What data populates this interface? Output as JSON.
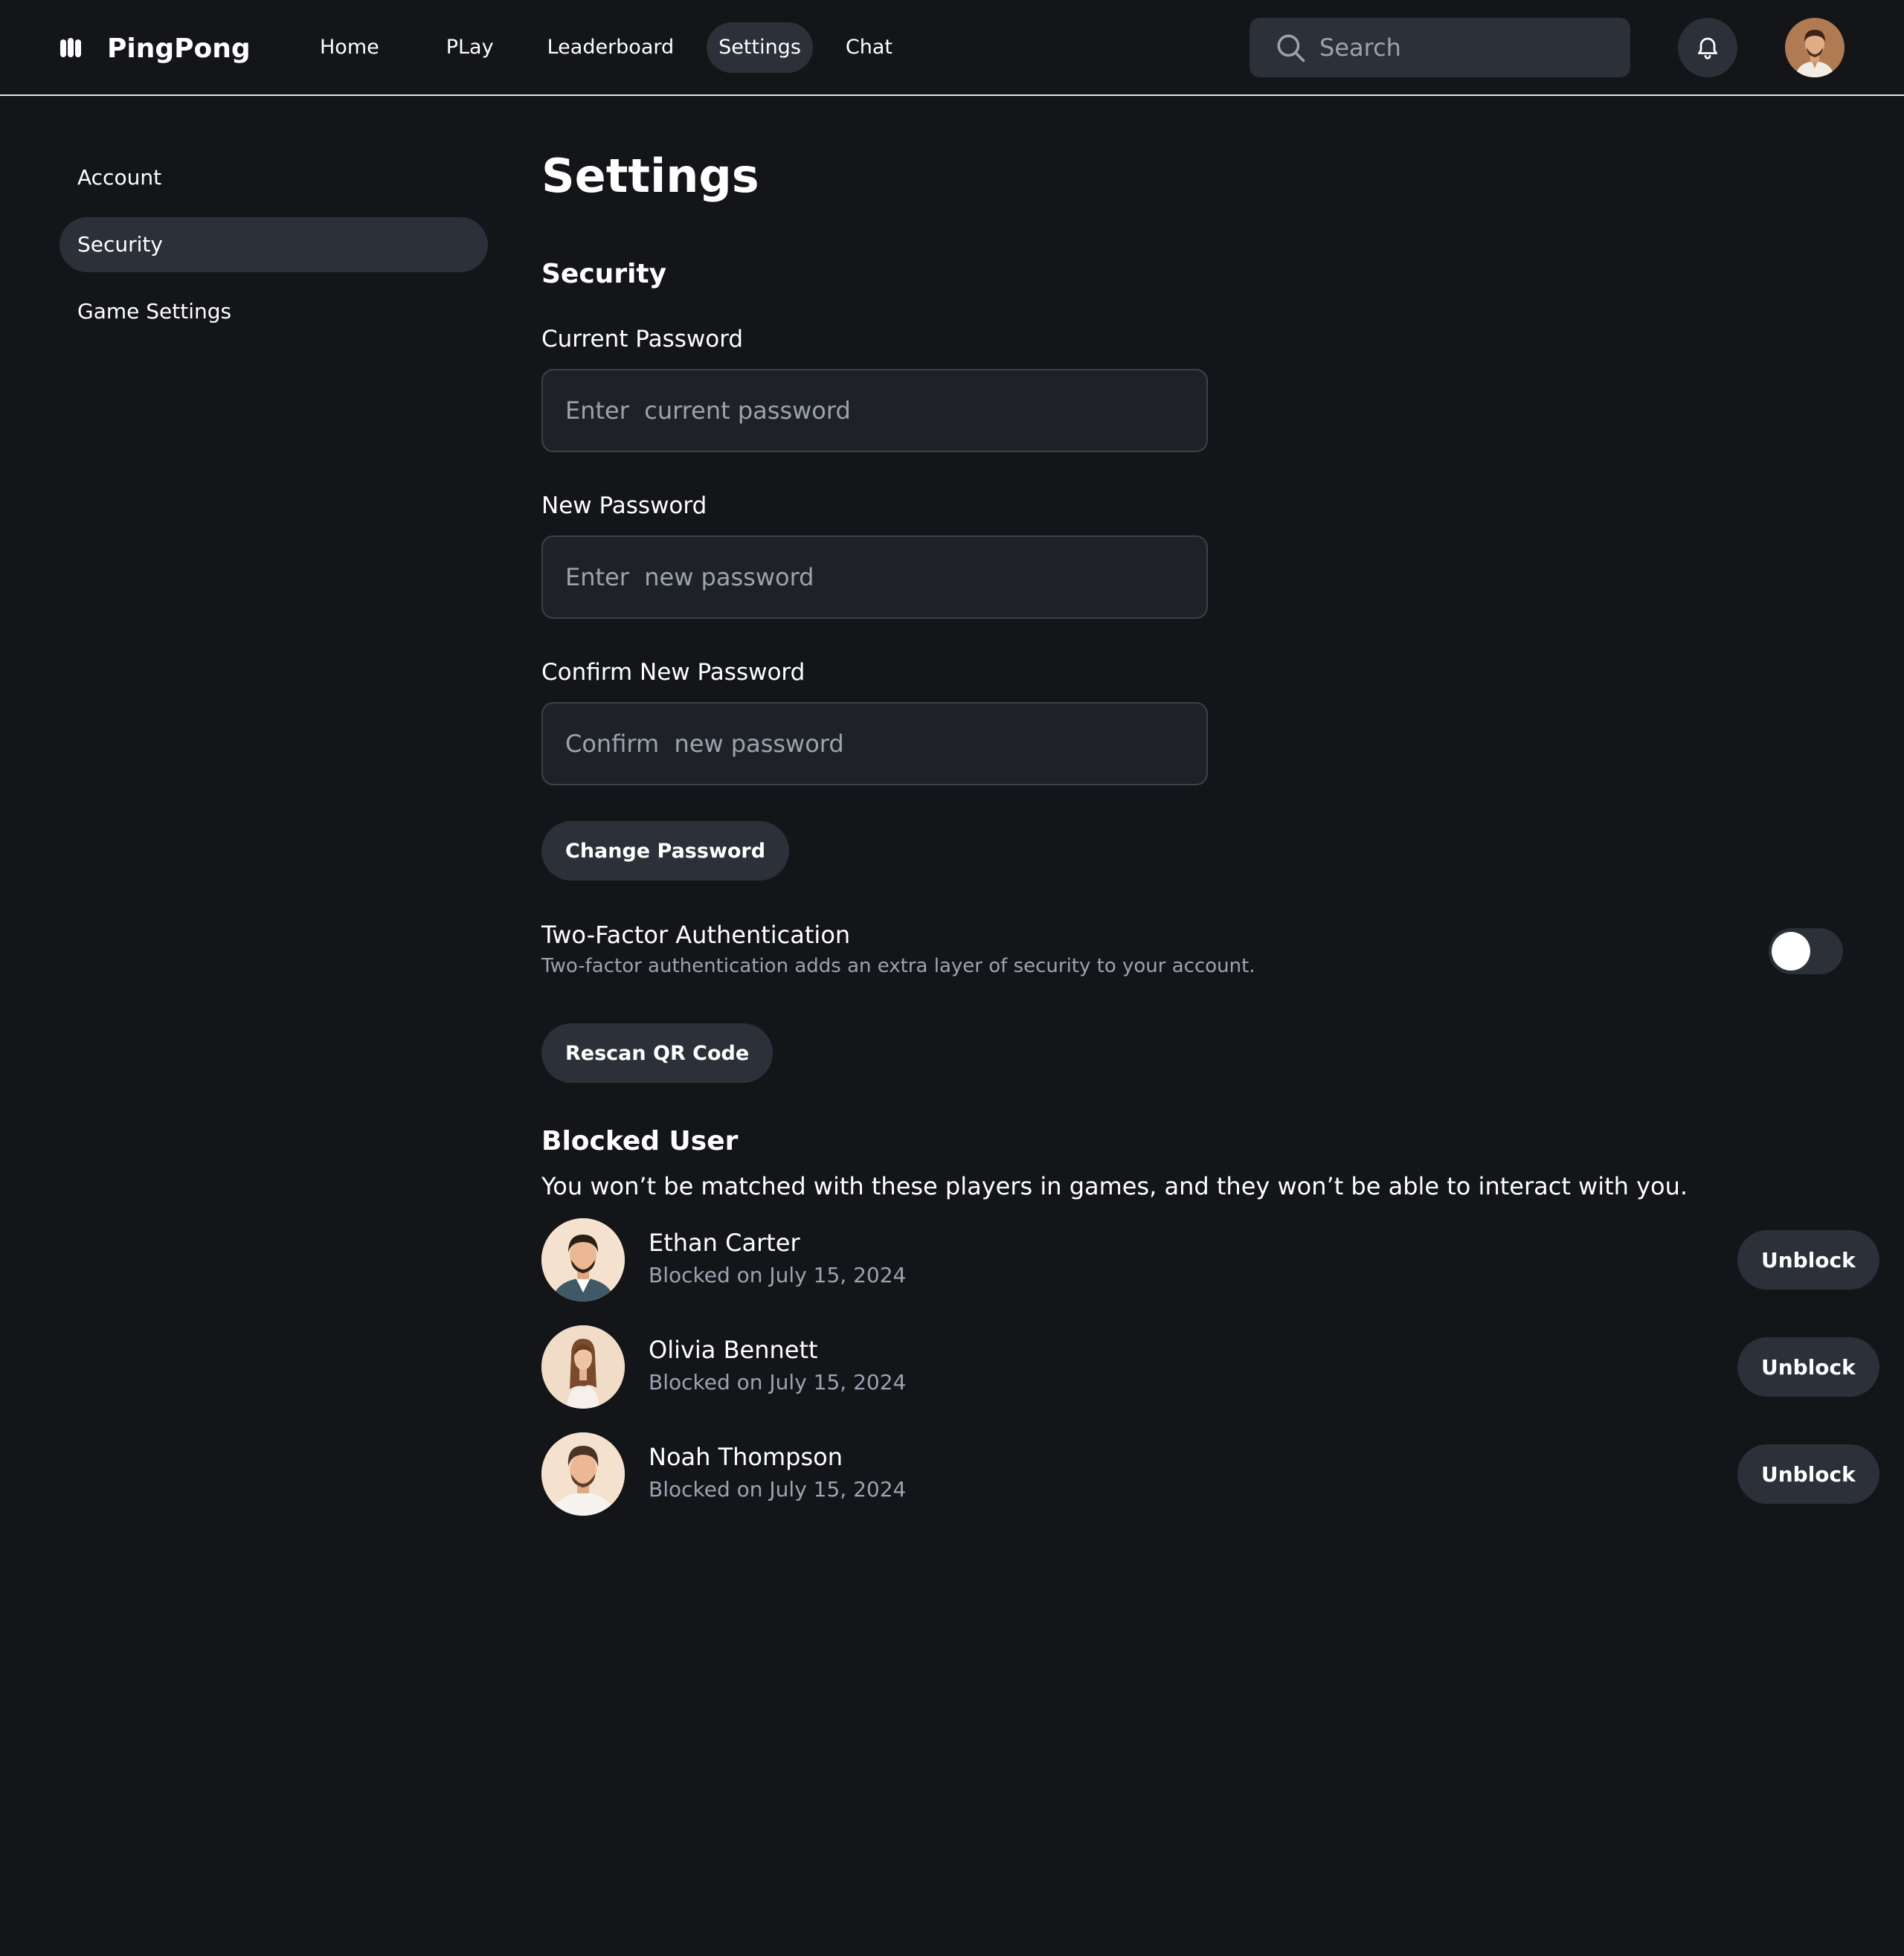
{
  "brand": {
    "name": "PingPong",
    "logo_icon": "logo-icon"
  },
  "nav": {
    "items": [
      {
        "label": "Home",
        "active": false
      },
      {
        "label": "PLay",
        "active": false
      },
      {
        "label": "Leaderboard",
        "active": false
      },
      {
        "label": "Settings",
        "active": true
      },
      {
        "label": "Chat",
        "active": false
      }
    ]
  },
  "search": {
    "placeholder": "Search",
    "icon": "search-icon"
  },
  "header_icons": {
    "notifications": "bell-icon",
    "profile": "user-avatar"
  },
  "sidebar": {
    "items": [
      {
        "label": "Account",
        "active": false
      },
      {
        "label": "Security",
        "active": true
      },
      {
        "label": "Game Settings",
        "active": false
      }
    ]
  },
  "page": {
    "title": "Settings",
    "section_title": "Security",
    "current_password": {
      "label": "Current Password",
      "placeholder": "Enter  current password",
      "value": ""
    },
    "new_password": {
      "label": "New Password",
      "placeholder": "Enter  new password",
      "value": ""
    },
    "confirm_password": {
      "label": "Confirm New Password",
      "placeholder": "Confirm  new password",
      "value": ""
    },
    "change_password_label": "Change Password",
    "two_factor": {
      "title": "Two-Factor Authentication",
      "description": "Two-factor authentication adds an extra layer of security to your account.",
      "enabled": false
    },
    "rescan_label": "Rescan QR Code",
    "blocked": {
      "title": "Blocked User",
      "description": "You won’t be matched with these players in games, and they won’t be able to interact with you.",
      "users": [
        {
          "name": "Ethan Carter",
          "date": "Blocked on July 15, 2024",
          "action": "Unblock"
        },
        {
          "name": "Olivia Bennett",
          "date": "Blocked on July 15, 2024",
          "action": "Unblock"
        },
        {
          "name": "Noah Thompson",
          "date": "Blocked on July 15, 2024",
          "action": "Unblock"
        }
      ]
    }
  },
  "colors": {
    "background": "#131519",
    "surface": "#2b3039",
    "field_background": "#1e2227",
    "muted_text": "#9ca3af",
    "text": "#ffffff"
  }
}
